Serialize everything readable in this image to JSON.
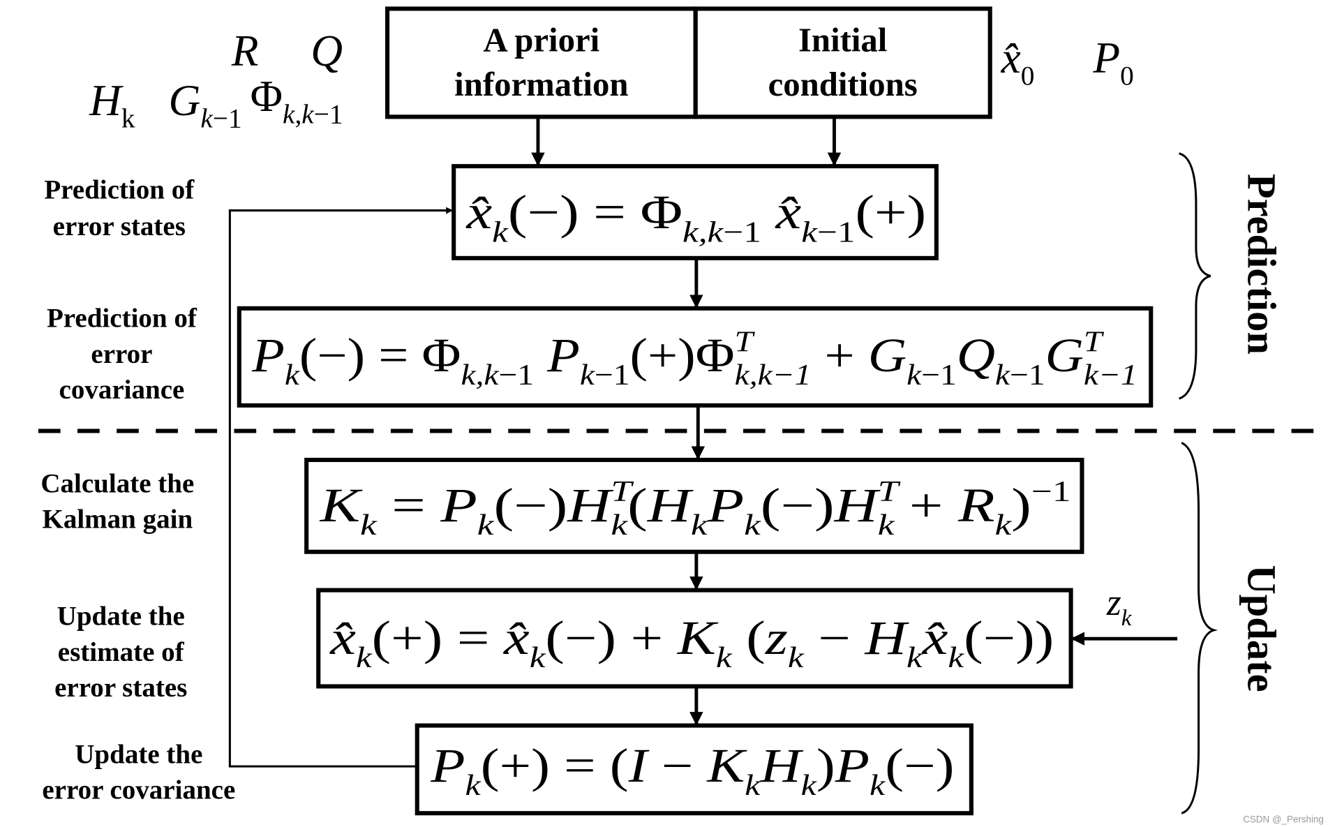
{
  "top": {
    "apriori": [
      "A priori",
      "information"
    ],
    "initial": [
      "Initial",
      "conditions"
    ]
  },
  "symbols": {
    "R": [
      [
        "R",
        "i"
      ]
    ],
    "Q": [
      [
        "Q",
        "i"
      ]
    ],
    "H": [
      [
        "H",
        "i"
      ],
      [
        "k",
        "sub"
      ]
    ],
    "G": [
      [
        "G",
        "i"
      ],
      [
        "k",
        "subi"
      ],
      [
        "−1",
        "sub"
      ]
    ],
    "Phi": [
      [
        "Φ",
        "n"
      ],
      [
        "k",
        "subi"
      ],
      [
        ",",
        "sub"
      ],
      [
        "k",
        "subi"
      ],
      [
        "−1",
        "sub"
      ]
    ],
    "x0": [
      [
        "x̂",
        "i"
      ],
      [
        "0",
        "sub"
      ]
    ],
    "P0": [
      [
        "P",
        "i"
      ],
      [
        "0",
        "sub"
      ]
    ],
    "zk": [
      [
        "z",
        "i"
      ],
      [
        "k",
        "subi"
      ]
    ]
  },
  "labels": {
    "pred_states": [
      "Prediction of",
      "error states"
    ],
    "pred_cov": [
      "Prediction of",
      "error",
      "covariance"
    ],
    "gain": [
      "Calculate the",
      "Kalman gain"
    ],
    "upd_states": [
      "Update the",
      "estimate of",
      "error states"
    ],
    "upd_cov": [
      "Update the",
      "error covariance"
    ]
  },
  "equations": {
    "eq1": [
      [
        "x̂",
        "i"
      ],
      [
        "k",
        "subi"
      ],
      [
        "(−) = Φ",
        "n"
      ],
      [
        "k,k",
        "subi"
      ],
      [
        "−1",
        "sub"
      ],
      [
        " x̂",
        "i"
      ],
      [
        "k",
        "subi"
      ],
      [
        "−1",
        "sub"
      ],
      [
        "(+)",
        "n"
      ]
    ],
    "eq2": [
      [
        "P",
        "i"
      ],
      [
        "k",
        "subi"
      ],
      [
        "(−) = Φ",
        "n"
      ],
      [
        "k,k",
        "subi"
      ],
      [
        "−1",
        "sub"
      ],
      [
        " P",
        "i"
      ],
      [
        "k",
        "subi"
      ],
      [
        "−1",
        "sub"
      ],
      [
        "(+)Φ",
        "n"
      ],
      [
        "T|k,k−1",
        "ss"
      ],
      [
        " + ",
        "n"
      ],
      [
        "G",
        "i"
      ],
      [
        "k",
        "subi"
      ],
      [
        "−1",
        "sub"
      ],
      [
        "Q",
        "i"
      ],
      [
        "k",
        "subi"
      ],
      [
        "−1",
        "sub"
      ],
      [
        "G",
        "i"
      ],
      [
        "T|k−1",
        "ss"
      ]
    ],
    "eq3": [
      [
        "K",
        "i"
      ],
      [
        "k",
        "subi"
      ],
      [
        " = ",
        "n"
      ],
      [
        "P",
        "i"
      ],
      [
        "k",
        "subi"
      ],
      [
        "(−)",
        "n"
      ],
      [
        "H",
        "i"
      ],
      [
        "T|k",
        "ss"
      ],
      [
        "(",
        "n"
      ],
      [
        "H",
        "i"
      ],
      [
        "k",
        "subi"
      ],
      [
        "P",
        "i"
      ],
      [
        "k",
        "subi"
      ],
      [
        "(−)",
        "n"
      ],
      [
        "H",
        "i"
      ],
      [
        "T|k",
        "ss"
      ],
      [
        " + ",
        "n"
      ],
      [
        "R",
        "i"
      ],
      [
        "k",
        "subi"
      ],
      [
        ")",
        "n"
      ],
      [
        "−1",
        "sup"
      ]
    ],
    "eq4": [
      [
        "x̂",
        "i"
      ],
      [
        "k",
        "subi"
      ],
      [
        "(+) = ",
        "n"
      ],
      [
        "x̂",
        "i"
      ],
      [
        "k",
        "subi"
      ],
      [
        "(−) + ",
        "n"
      ],
      [
        "K",
        "i"
      ],
      [
        "k",
        "subi"
      ],
      [
        " (",
        "n"
      ],
      [
        "z",
        "i"
      ],
      [
        "k",
        "subi"
      ],
      [
        " − ",
        "n"
      ],
      [
        "H",
        "i"
      ],
      [
        "k",
        "subi"
      ],
      [
        "x̂",
        "i"
      ],
      [
        "k",
        "subi"
      ],
      [
        "(−))",
        "n"
      ]
    ],
    "eq5": [
      [
        "P",
        "i"
      ],
      [
        "k",
        "subi"
      ],
      [
        "(+) = (",
        "n"
      ],
      [
        "I",
        "i"
      ],
      [
        " − ",
        "n"
      ],
      [
        "K",
        "i"
      ],
      [
        "k",
        "subi"
      ],
      [
        "H",
        "i"
      ],
      [
        "k",
        "subi"
      ],
      [
        ")",
        "n"
      ],
      [
        "P",
        "i"
      ],
      [
        "k",
        "subi"
      ],
      [
        "(−)",
        "n"
      ]
    ]
  },
  "sections": {
    "prediction": "Prediction",
    "update": "Update"
  },
  "watermark": "CSDN @_Pershing"
}
